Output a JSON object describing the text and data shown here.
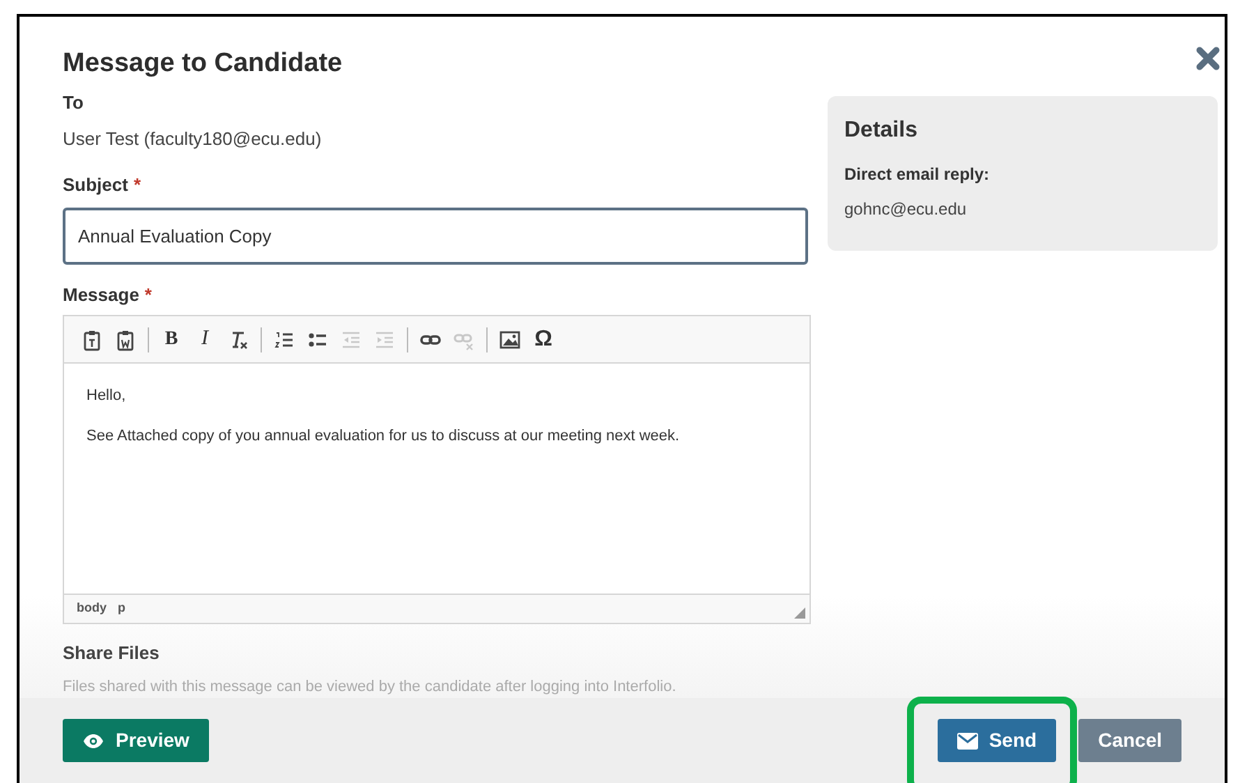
{
  "dialog": {
    "title": "Message to Candidate"
  },
  "to": {
    "label": "To",
    "value": "User Test (faculty180@ecu.edu)"
  },
  "subject": {
    "label": "Subject",
    "required_mark": "*",
    "value": "Annual Evaluation Copy"
  },
  "message": {
    "label": "Message",
    "required_mark": "*",
    "toolbar": [
      {
        "kind": "paste-text",
        "disabled": false
      },
      {
        "kind": "paste-word",
        "disabled": false
      },
      {
        "kind": "separator"
      },
      {
        "kind": "bold",
        "glyph": "B",
        "disabled": false
      },
      {
        "kind": "italic",
        "glyph": "I",
        "disabled": false
      },
      {
        "kind": "remove-format",
        "disabled": false
      },
      {
        "kind": "separator"
      },
      {
        "kind": "numbered-list",
        "disabled": false
      },
      {
        "kind": "bulleted-list",
        "disabled": false
      },
      {
        "kind": "outdent",
        "disabled": true
      },
      {
        "kind": "indent",
        "disabled": true
      },
      {
        "kind": "separator"
      },
      {
        "kind": "link",
        "disabled": false
      },
      {
        "kind": "unlink",
        "disabled": true
      },
      {
        "kind": "separator"
      },
      {
        "kind": "image",
        "disabled": false
      },
      {
        "kind": "special-character",
        "glyph": "Ω",
        "disabled": false
      }
    ],
    "body": [
      "Hello,",
      "See Attached copy of you annual evaluation for us to discuss at our meeting next week."
    ],
    "path": [
      "body",
      "p"
    ]
  },
  "share_files": {
    "label": "Share Files",
    "hint": "Files shared with this message can be viewed by the candidate after logging into Interfolio."
  },
  "details": {
    "title": "Details",
    "label": "Direct email reply:",
    "value": "gohnc@ecu.edu"
  },
  "buttons": [
    {
      "kind": "preview",
      "label": "Preview"
    },
    {
      "kind": "send",
      "label": "Send",
      "highlighted": true
    },
    {
      "kind": "cancel",
      "label": "Cancel"
    }
  ]
}
